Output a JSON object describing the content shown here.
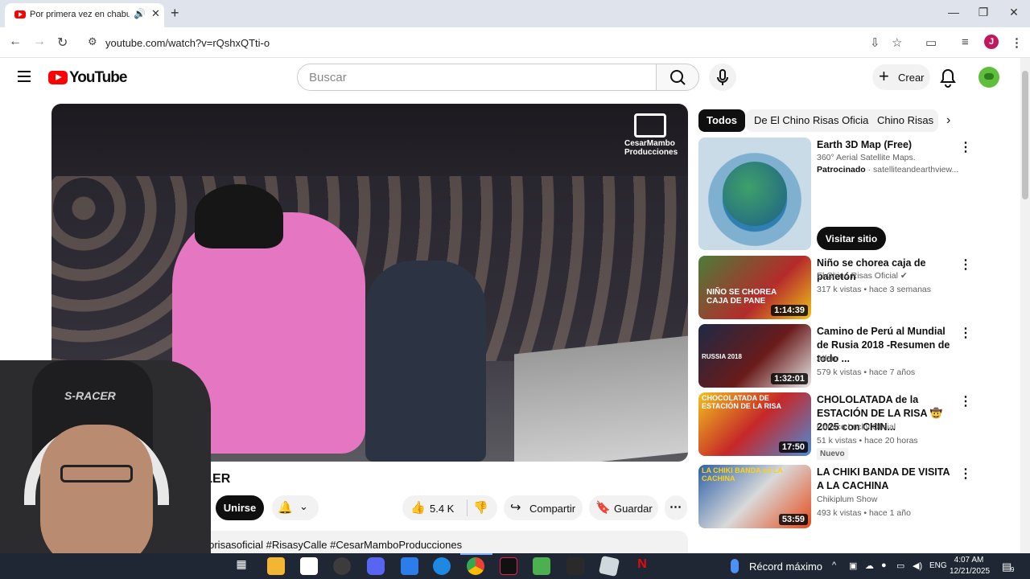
{
  "browser": {
    "tab_title": "Por primera vez en chabuca",
    "url": "youtube.com/watch?v=rQshxQTti-o",
    "profile_initial": "J"
  },
  "youtube": {
    "logo_text": "YouTube",
    "search_placeholder": "Buscar",
    "create_label": "Crear"
  },
  "video": {
    "watermark": "CesarMambo Producciones",
    "title": "ca la coreografia de THILLER",
    "join_label": "Unirse",
    "likes": "5.4 K",
    "share_label": "Compartir",
    "save_label": "Guardar",
    "description_tags": "inorisasoficial #RisasyCalle #CesarMamboProducciones"
  },
  "webcam": {
    "chair_text": "S-RACER"
  },
  "sidebar": {
    "chips": [
      "Todos",
      "De El Chino Risas Oficial",
      "Chino Risas"
    ],
    "ad": {
      "title": "Earth 3D Map (Free)",
      "subtitle": "360° Aerial Satellite Maps.",
      "sponsored": "Patrocinado",
      "domain": "satelliteandearthview...",
      "button": "Visitar sitio"
    },
    "videos": [
      {
        "title": "Niño se chorea caja de panetón",
        "channel": "El Chino Risas Oficial",
        "meta": "317 k vistas • hace 3 semanas",
        "duration": "1:14:39",
        "verified": "✔",
        "thumb_text": "NIÑO SE CHOREA CAJA DE PANE",
        "badge": ""
      },
      {
        "title": "Camino de Perú al Mundial de Rusia 2018 -Resumen de todo ...",
        "channel": "Alfaro",
        "meta": "579 k vistas • hace 7 años",
        "duration": "1:32:01",
        "verified": "",
        "thumb_text": "RUSSIA 2018",
        "badge": ""
      },
      {
        "title": "CHOLOLATADA de la ESTACIÓN DE LA RISA 🤠 2025 con CHIN...",
        "channel": "Comico Lucky Oficial",
        "meta": "51 k vistas • hace 20 horas",
        "duration": "17:50",
        "verified": "",
        "thumb_text": "CHOCOLATADA DE ESTACIÓN DE LA RISA",
        "badge": "Nuevo"
      },
      {
        "title": "LA CHIKI BANDA DE VISITA A LA CACHINA",
        "channel": "Chikiplum Show",
        "meta": "493 k vistas • hace 1 año",
        "duration": "53:59",
        "verified": "",
        "thumb_text": "LA CHIKI BANDA en LA CACHINA",
        "badge": ""
      }
    ]
  },
  "taskbar": {
    "record_label": "Récord máximo",
    "language": "ENG",
    "time": "4:07 AM",
    "date": "12/21/2025",
    "notifications": "9"
  },
  "colors": {
    "youtube_red": "#ff0000",
    "taskbar_bg": "#1f2735",
    "chip_active": "#0f0f0f"
  }
}
